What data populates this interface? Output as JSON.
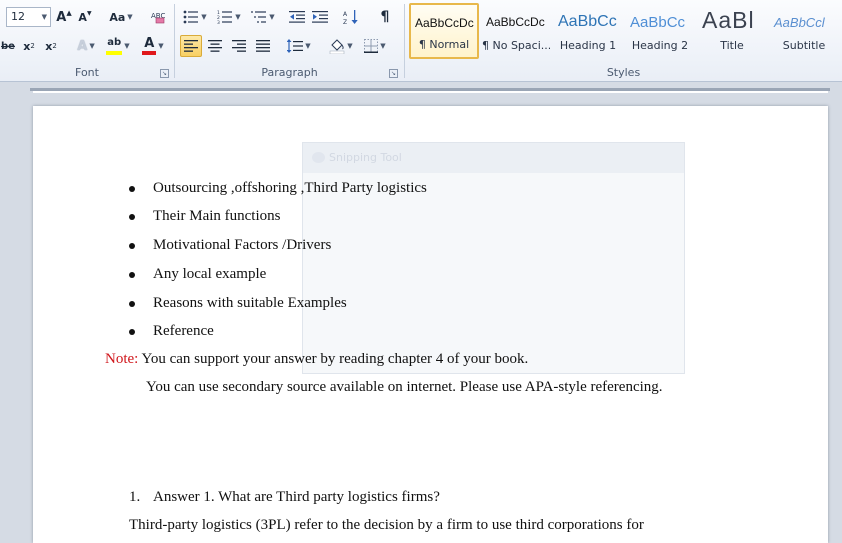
{
  "font_group": {
    "label": "Font",
    "font_size": "12"
  },
  "paragraph_group": {
    "label": "Paragraph"
  },
  "styles_group": {
    "label": "Styles",
    "tiles": [
      {
        "sample": "AaBbCcDc",
        "name": "¶ Normal"
      },
      {
        "sample": "AaBbCcDc",
        "name": "¶ No Spaci..."
      },
      {
        "sample": "AaBbCc",
        "name": "Heading 1"
      },
      {
        "sample": "AaBbCc",
        "name": "Heading 2"
      },
      {
        "sample": "AaBl",
        "name": "Title"
      },
      {
        "sample": "AaBbCcl",
        "name": "Subtitle"
      }
    ]
  },
  "snipping_tool": {
    "title": "Snipping Tool"
  },
  "document": {
    "bullets": [
      "Outsourcing ,offshoring ,Third Party logistics",
      "Their Main functions",
      "Motivational Factors /Drivers",
      "Any local example",
      "Reasons with suitable Examples",
      "Reference"
    ],
    "note_label": "Note:",
    "note_line1": "You can support your answer by reading chapter 4 of your book.",
    "note_line2": "You can use secondary source available on internet. Please use APA-style referencing.",
    "answer_number": "1.",
    "answer_heading": "Answer 1. What are Third party logistics firms?",
    "body_text": "Third-party logistics (3PL) refer to the decision by a firm to use third corporations for"
  },
  "colors": {
    "note_red": "#d0161b",
    "highlight_yellow": "#ffff00",
    "font_color_red": "#e0181b",
    "heading_blue": "#2e74b5"
  }
}
